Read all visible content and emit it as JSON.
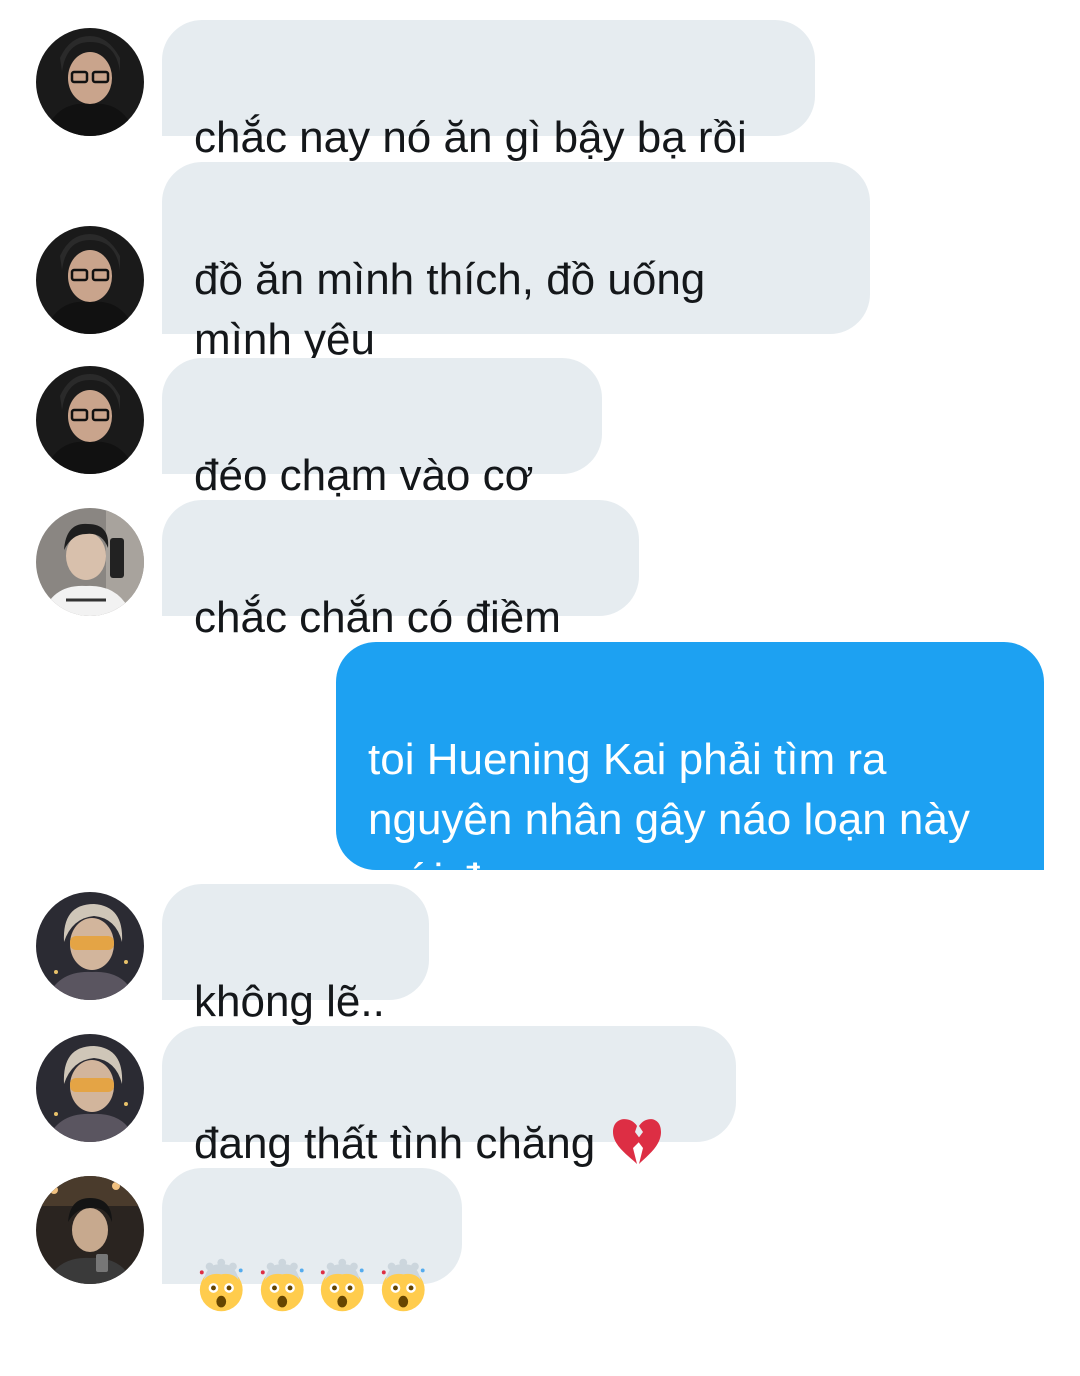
{
  "messages": [
    {
      "sender": "avatar-a",
      "text": "chắc nay nó ăn gì bậy bạ rồi"
    },
    {
      "sender": "avatar-a",
      "text": "đồ ăn mình thích, đồ uống\nmình yêu"
    },
    {
      "sender": "avatar-a",
      "text": "đéo chạm vào cơ"
    },
    {
      "sender": "avatar-b",
      "text": "chắc chắn có điềm"
    },
    {
      "sender": "me",
      "text": "toi Huening Kai phải tìm ra\nnguyên nhân gây náo loạn này\nmới đượccccc"
    },
    {
      "sender": "avatar-c",
      "text": "không lẽ.."
    },
    {
      "sender": "avatar-c",
      "text": "đang thất tình chăng",
      "emoji": "broken-heart-icon"
    },
    {
      "sender": "avatar-d",
      "emoji_repeat": 4,
      "emoji": "exploding-head-icon"
    }
  ],
  "colors": {
    "received_bubble": "#e6ecf0",
    "sent_bubble": "#1da1f2",
    "received_text": "#14171a",
    "sent_text": "#ffffff"
  }
}
